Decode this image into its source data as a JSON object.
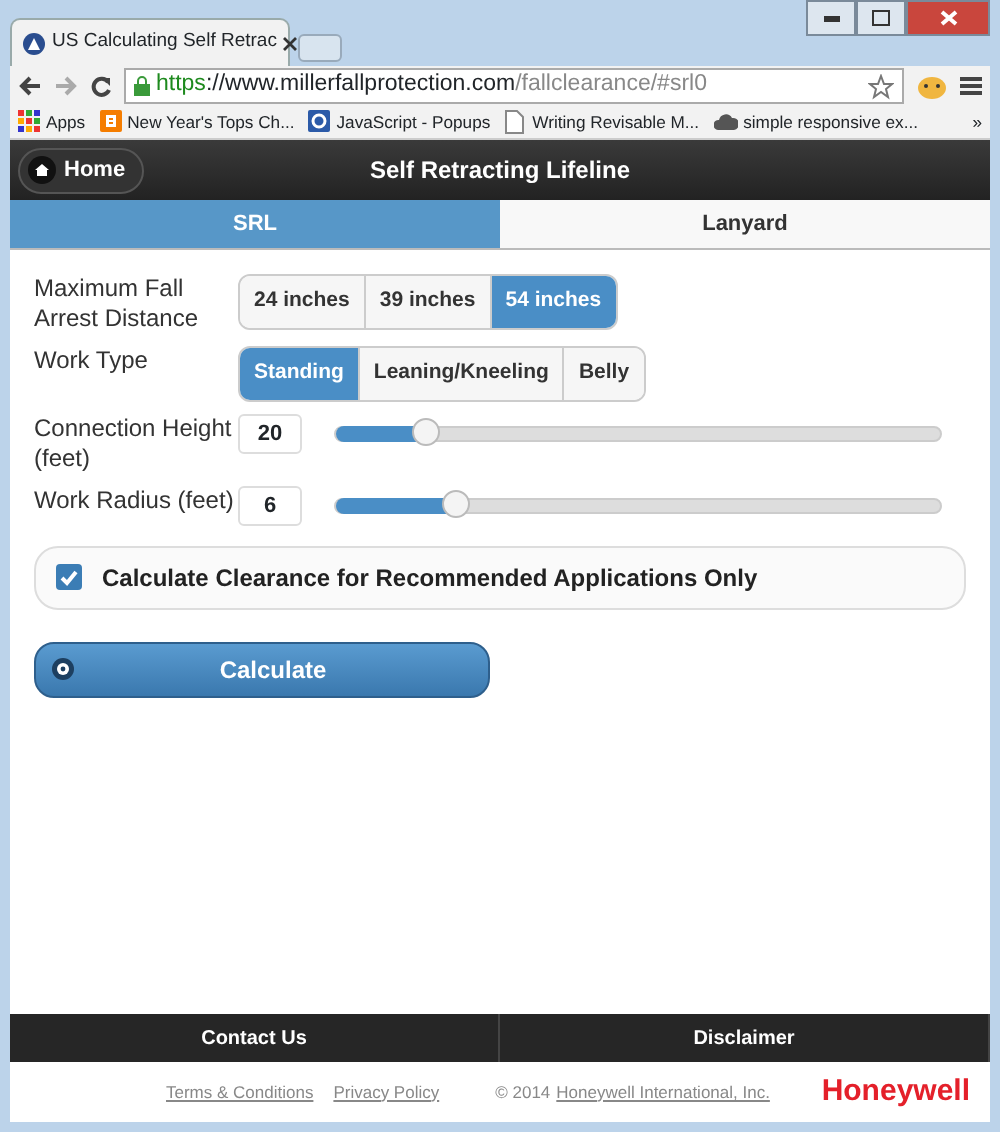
{
  "browser": {
    "tab_title": "US Calculating Self Retrac",
    "url": {
      "scheme": "https",
      "host": "://www.millerfallprotection.com",
      "path": "/fallclearance/#srl0"
    },
    "bookmarks": [
      {
        "label": "Apps"
      },
      {
        "label": "New Year's Tops Ch..."
      },
      {
        "label": "JavaScript - Popups"
      },
      {
        "label": "Writing Revisable M..."
      },
      {
        "label": "simple responsive ex..."
      }
    ],
    "overflow": "»"
  },
  "header": {
    "home": "Home",
    "title": "Self Retracting Lifeline"
  },
  "tabs": [
    {
      "label": "SRL",
      "selected": true
    },
    {
      "label": "Lanyard",
      "selected": false
    }
  ],
  "fields": [
    {
      "kind": "segmented",
      "label": "Maximum Fall Arrest Distance",
      "options": [
        {
          "label": "24 inches",
          "selected": false
        },
        {
          "label": "39 inches",
          "selected": false
        },
        {
          "label": "54 inches",
          "selected": true
        }
      ]
    },
    {
      "kind": "segmented",
      "label": "Work Type",
      "options": [
        {
          "label": "Standing",
          "selected": true
        },
        {
          "label": "Leaning/Kneeling",
          "selected": false
        },
        {
          "label": "Belly",
          "selected": false
        }
      ]
    },
    {
      "kind": "slider",
      "label": "Connection Height (feet)",
      "value": "20",
      "level": 0.15
    },
    {
      "kind": "slider",
      "label": "Work Radius (feet)",
      "value": "6",
      "level": 0.2
    }
  ],
  "checkbox": {
    "label": "Calculate Clearance for Recommended Applications Only",
    "checked": true
  },
  "calculate": "Calculate",
  "footer_nav": [
    "Contact Us",
    "Disclaimer"
  ],
  "footer": {
    "links": [
      "Terms & Conditions",
      "Privacy Policy"
    ],
    "copyright": "© 2014",
    "company_link": "Honeywell International, Inc.",
    "logo": "Honeywell"
  }
}
